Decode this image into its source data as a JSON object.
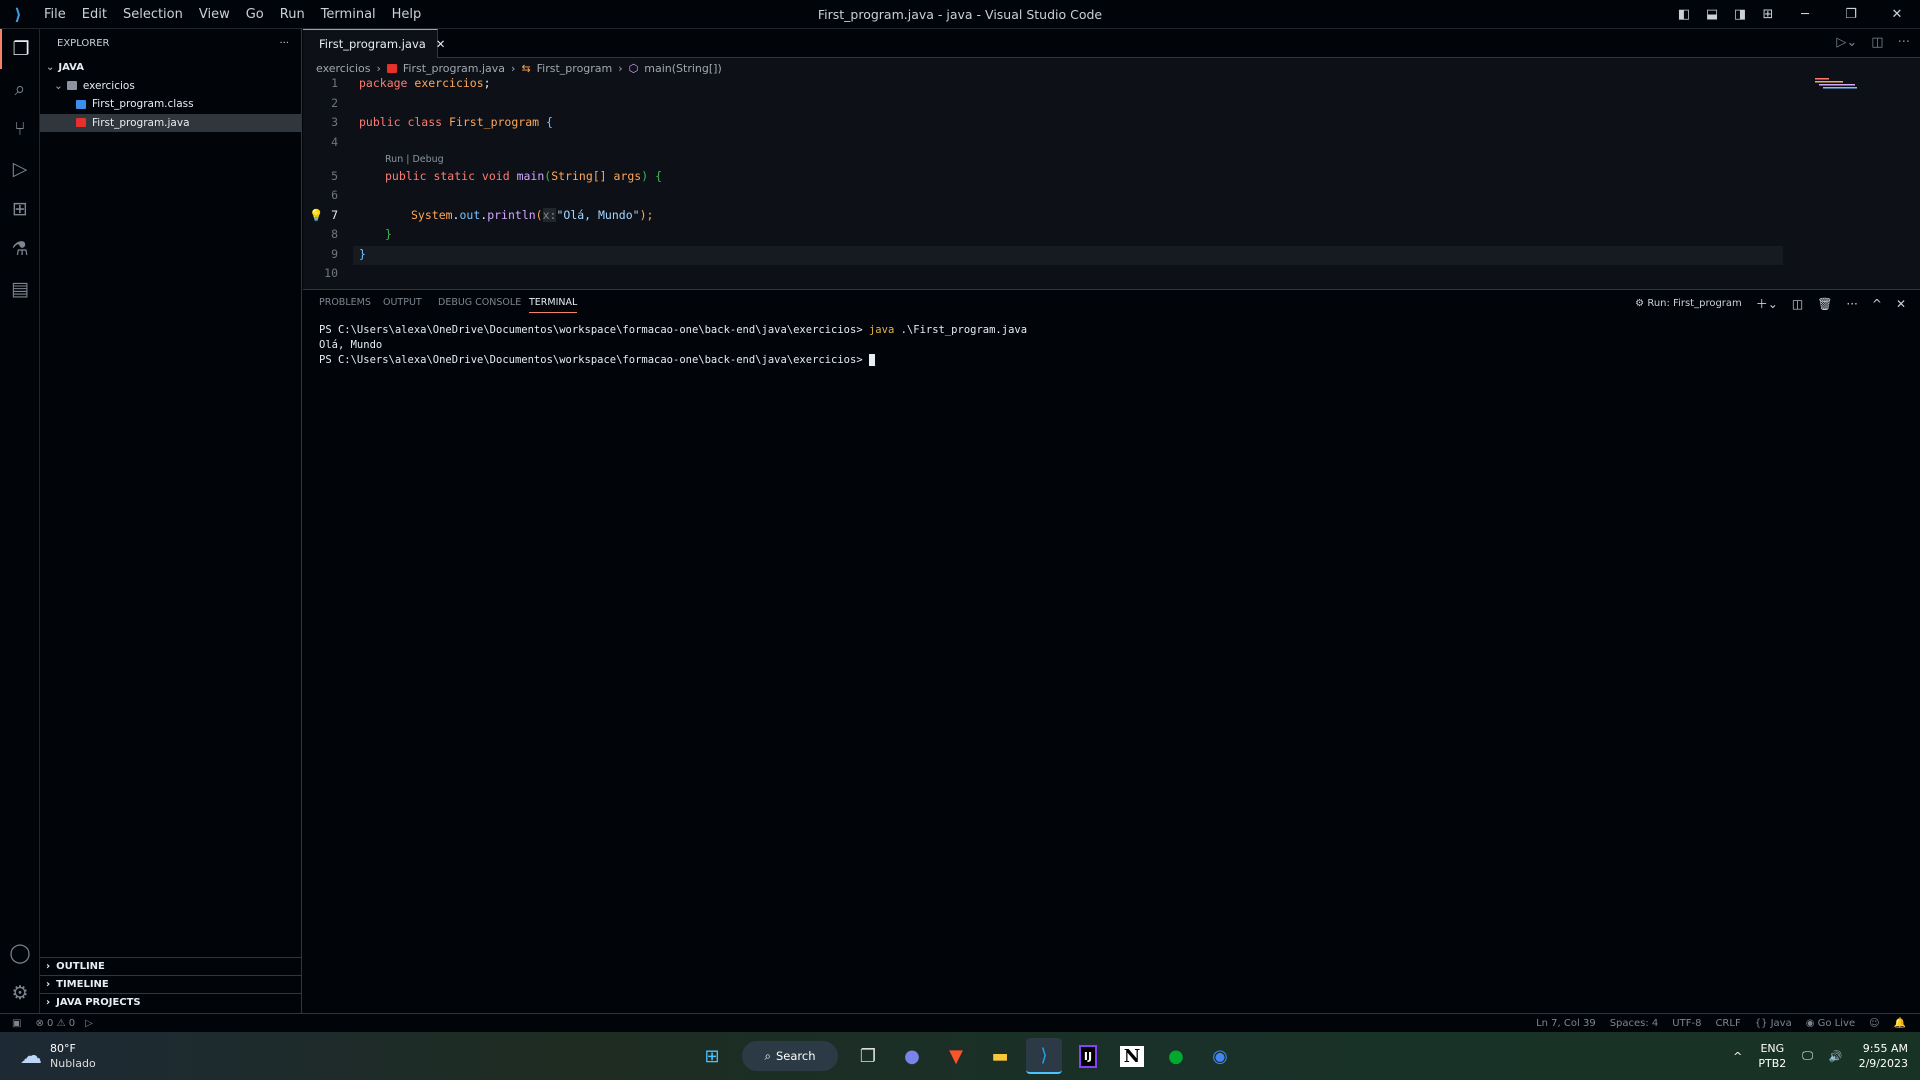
{
  "window": {
    "title": "First_program.java - java - Visual Studio Code",
    "menu": [
      "File",
      "Edit",
      "Selection",
      "View",
      "Go",
      "Run",
      "Terminal",
      "Help"
    ]
  },
  "sidebar": {
    "title": "EXPLORER",
    "root": "JAVA",
    "folder": "exercicios",
    "files": [
      {
        "name": "First_program.class",
        "color": "#3b8eea"
      },
      {
        "name": "First_program.java",
        "color": "#e5302b",
        "selected": true
      }
    ],
    "sections": [
      "OUTLINE",
      "TIMELINE",
      "JAVA PROJECTS"
    ]
  },
  "editor": {
    "tab": "First_program.java",
    "breadcrumb": [
      "exercicios",
      "First_program.java",
      "First_program",
      "main(String[])"
    ],
    "codelens": "Run | Debug",
    "line_numbers": [
      "1",
      "2",
      "3",
      "4",
      "5",
      "6",
      "7",
      "8",
      "9",
      "10"
    ],
    "code": {
      "l1a": "package",
      "l1b": "exercicios",
      "l1c": ";",
      "l3a": "public class",
      "l3b": "First_program",
      "l3c": "{",
      "l5a": "public static void",
      "l5b": "main",
      "l5c": "(",
      "l5d": "String[] args",
      "l5e": ")",
      "l5f": "{",
      "l7a": "System",
      "l7b": ".",
      "l7c": "out",
      "l7d": ".",
      "l7e": "println",
      "l7f": "(",
      "l7hint": "x:",
      "l7g": "\"Olá, Mundo\"",
      "l7h": ");",
      "l8": "}",
      "l9": "}"
    },
    "current_line": 7
  },
  "panel": {
    "tabs": [
      "PROBLEMS",
      "OUTPUT",
      "DEBUG CONSOLE",
      "TERMINAL"
    ],
    "active_tab": "TERMINAL",
    "terminal_name": "Run: First_program",
    "lines": {
      "p1": "PS C:\\Users\\alexa\\OneDrive\\Documentos\\workspace\\formacao-one\\back-end\\java\\exercicios> ",
      "cmd": "java",
      "args": " .\\First_program.java",
      "out": "Olá, Mundo",
      "p2": "PS C:\\Users\\alexa\\OneDrive\\Documentos\\workspace\\formacao-one\\back-end\\java\\exercicios> "
    }
  },
  "status": {
    "errors": "0",
    "warnings": "0",
    "position": "Ln 7, Col 39",
    "spaces": "Spaces: 4",
    "encoding": "UTF-8",
    "eol": "CRLF",
    "language": "Java",
    "golive": "Go Live"
  },
  "taskbar": {
    "temp": "80°F",
    "weather": "Nublado",
    "search": "Search",
    "lang1": "ENG",
    "lang2": "PTB2",
    "time": "9:55 AM",
    "date": "2/9/2023"
  }
}
